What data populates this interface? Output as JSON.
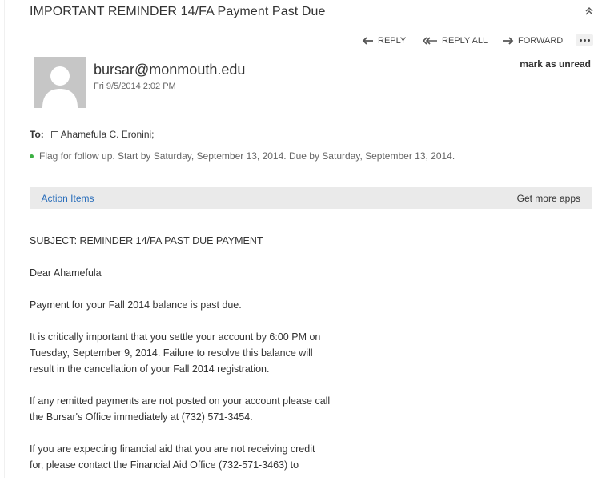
{
  "header": {
    "subject": "IMPORTANT REMINDER 14/FA Payment Past Due",
    "collapse_icon": "double-chevron-up-icon"
  },
  "toolbar": {
    "reply": "REPLY",
    "reply_all": "REPLY ALL",
    "forward": "FORWARD",
    "more_icon": "ellipsis-icon"
  },
  "message": {
    "sender": "bursar@monmouth.edu",
    "date": "Fri 9/5/2014 2:02 PM",
    "mark_unread": "mark as unread",
    "to_label": "To:",
    "recipient": "Ahamefula C. Eronini;",
    "flag_text": "Flag for follow up. Start by Saturday, September 13, 2014. Due by Saturday, September 13, 2014.",
    "flag_color": "#3cb043"
  },
  "appbar": {
    "tab": "Action Items",
    "get_more": "Get more apps",
    "accent": "#2a6ebb"
  },
  "body": {
    "line_subject": "SUBJECT:  REMINDER 14/FA PAST DUE PAYMENT",
    "greeting": "Dear Ahamefula",
    "p1": "Payment for your Fall 2014 balance is past due.",
    "p2a": "It is critically important that you settle your account by 6:00 PM on",
    "p2b": "Tuesday, September 9, 2014.  Failure to resolve this balance will",
    "p2c": "result in the cancellation of your Fall 2014 registration.",
    "p3a": "If any remitted payments are not posted on your account please call",
    "p3b": "the Bursar's Office immediately at (732) 571-3454.",
    "p4a": "If you are expecting financial aid that you are not receiving credit",
    "p4b": "for, please contact the Financial Aid Office (732-571-3463) to"
  }
}
